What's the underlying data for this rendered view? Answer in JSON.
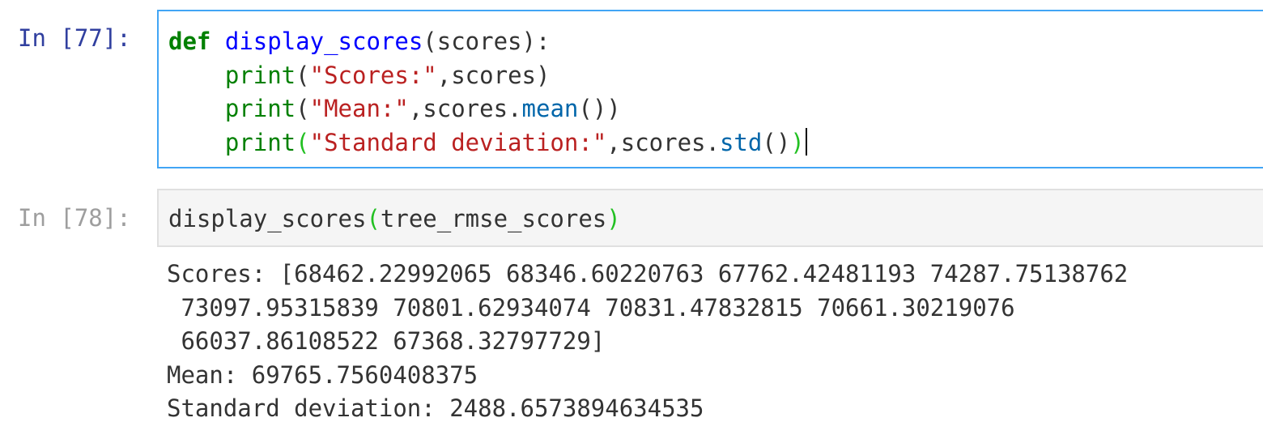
{
  "cells": [
    {
      "prompt": "In [77]:",
      "state": "selected",
      "lines": [
        [
          {
            "t": "def",
            "c": "kw"
          },
          {
            "t": " ",
            "c": "def"
          },
          {
            "t": "display_scores",
            "c": "fn"
          },
          {
            "t": "(scores):",
            "c": "def"
          }
        ],
        [
          {
            "t": "    ",
            "c": "def"
          },
          {
            "t": "print",
            "c": "bi"
          },
          {
            "t": "(",
            "c": "def"
          },
          {
            "t": "\"Scores:\"",
            "c": "str"
          },
          {
            "t": ",scores)",
            "c": "def"
          }
        ],
        [
          {
            "t": "    ",
            "c": "def"
          },
          {
            "t": "print",
            "c": "bi"
          },
          {
            "t": "(",
            "c": "def"
          },
          {
            "t": "\"Mean:\"",
            "c": "str"
          },
          {
            "t": ",scores.",
            "c": "def"
          },
          {
            "t": "mean",
            "c": "attr"
          },
          {
            "t": "())",
            "c": "def"
          }
        ],
        [
          {
            "t": "    ",
            "c": "def"
          },
          {
            "t": "print",
            "c": "bi"
          },
          {
            "t": "(",
            "c": "paren-match"
          },
          {
            "t": "\"Standard deviation:\"",
            "c": "str"
          },
          {
            "t": ",scores.",
            "c": "def"
          },
          {
            "t": "std",
            "c": "attr"
          },
          {
            "t": "()",
            "c": "def"
          },
          {
            "t": ")",
            "c": "paren-match"
          }
        ]
      ]
    },
    {
      "prompt": "In [78]:",
      "state": "normal",
      "lines": [
        [
          {
            "t": "display_scores",
            "c": "def"
          },
          {
            "t": "(",
            "c": "paren-match"
          },
          {
            "t": "tree_rmse_scores",
            "c": "def"
          },
          {
            "t": ")",
            "c": "paren-match"
          }
        ]
      ],
      "output": [
        "Scores: [68462.22992065 68346.60220763 67762.42481193 74287.75138762",
        " 73097.95315839 70801.62934074 70831.47832815 70661.30219076",
        " 66037.86108522 67368.32797729]",
        "Mean: 69765.7560408375",
        "Standard deviation: 2488.6573894634535"
      ]
    }
  ]
}
